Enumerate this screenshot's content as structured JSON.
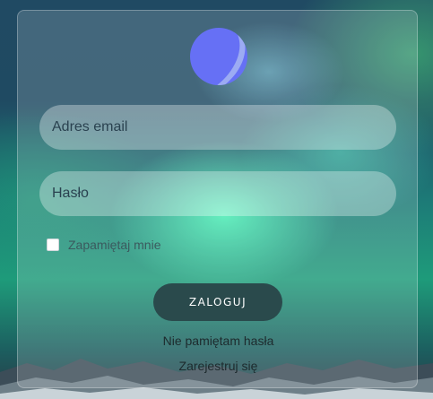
{
  "form": {
    "email_placeholder": "Adres email",
    "password_placeholder": "Hasło",
    "remember_label": "Zapamiętaj mnie",
    "remember_checked": false,
    "login_label": "ZALOGUJ",
    "forgot_label": "Nie pamiętam hasła",
    "register_label": "Zarejestruj się"
  },
  "icons": {
    "logo": "planet-logo-icon"
  },
  "colors": {
    "logo": "#6670f5",
    "button": "#2a4a4c",
    "card": "rgba(255,255,255,0.16)"
  }
}
